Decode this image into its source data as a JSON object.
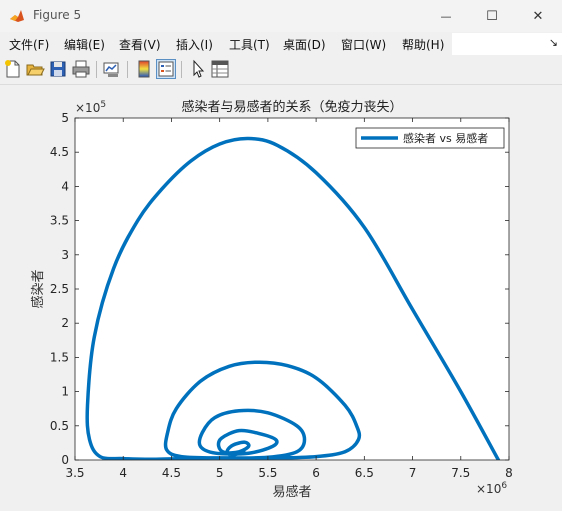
{
  "window": {
    "title": "Figure 5",
    "minimize_symbol": "—",
    "maximize_symbol": "☐",
    "close_symbol": "✕"
  },
  "menu": {
    "items": [
      "文件(F)",
      "编辑(E)",
      "查看(V)",
      "插入(I)",
      "工具(T)",
      "桌面(D)",
      "窗口(W)",
      "帮助(H)"
    ],
    "overflow_symbol": "↘"
  },
  "toolbar": {
    "icons": [
      "new-figure-icon",
      "open-file-icon",
      "save-icon",
      "print-icon",
      "link-plot-icon",
      "insert-colorbar-icon",
      "insert-legend-icon",
      "pointer-icon",
      "property-inspector-icon"
    ]
  },
  "colors": {
    "line": "#0072bd",
    "axes_bg": "#ffffff",
    "figure_bg": "#f0f0f0"
  },
  "chart_data": {
    "type": "line",
    "title": "感染者与易感者的关系（免疫力丧失）",
    "xlabel": "易感者",
    "ylabel": "感染者",
    "xlim": [
      3500000,
      8000000
    ],
    "ylim": [
      0,
      500000
    ],
    "xticks": [
      3500000,
      4000000,
      4500000,
      5000000,
      5500000,
      6000000,
      6500000,
      7000000,
      7500000,
      8000000
    ],
    "xtick_labels": [
      "3.5",
      "4",
      "4.5",
      "5",
      "5.5",
      "6",
      "6.5",
      "7",
      "7.5",
      "8"
    ],
    "yticks": [
      0,
      50000,
      100000,
      150000,
      200000,
      250000,
      300000,
      350000,
      400000,
      450000,
      500000
    ],
    "ytick_labels": [
      "0",
      "0.5",
      "1",
      "1.5",
      "2",
      "2.5",
      "3",
      "3.5",
      "4",
      "4.5",
      "5"
    ],
    "x_exponent": "×10",
    "x_exponent_power": "6",
    "y_exponent": "×10",
    "y_exponent_power": "5",
    "legend_position": "top-right",
    "grid": false,
    "series": [
      {
        "name": "感染者 vs 易感者",
        "x": [
          7890000,
          7500000,
          7000000,
          6500000,
          6000000,
          5600000,
          5300000,
          5000000,
          4700000,
          4400000,
          4150000,
          3900000,
          3700000,
          3630000,
          3650000,
          3760000,
          4000000,
          4300000,
          4600000,
          5000000,
          5600000,
          6000000,
          6300000,
          6440000,
          6420000,
          6300000,
          6000000,
          5700000,
          5400000,
          5100000,
          4800000,
          4550000,
          4460000,
          4450000,
          4600000,
          5000000,
          5500000,
          5800000,
          5880000,
          5800000,
          5500000,
          5200000,
          4950000,
          4820000,
          4800000,
          4960000,
          5300000,
          5550000,
          5580000,
          5400000,
          5200000,
          5020000,
          4990000,
          5050000,
          5200000,
          5300000,
          5260000,
          5140000,
          5080000,
          5100000,
          5200000,
          5250000
        ],
        "y": [
          0,
          100000,
          220000,
          340000,
          420000,
          460000,
          470000,
          462000,
          437000,
          396000,
          350000,
          280000,
          180000,
          80000,
          30000,
          5000,
          2000,
          1000,
          2000,
          3000,
          3000,
          5000,
          12000,
          30000,
          50000,
          80000,
          120000,
          138000,
          143000,
          137000,
          115000,
          75000,
          40000,
          15000,
          5000,
          3000,
          4000,
          12000,
          30000,
          50000,
          69000,
          72000,
          62000,
          40000,
          20000,
          10000,
          10000,
          20000,
          30000,
          39000,
          43000,
          32000,
          20000,
          11000,
          12000,
          20000,
          26000,
          22000,
          14000,
          8000,
          9000,
          12000
        ]
      }
    ]
  }
}
